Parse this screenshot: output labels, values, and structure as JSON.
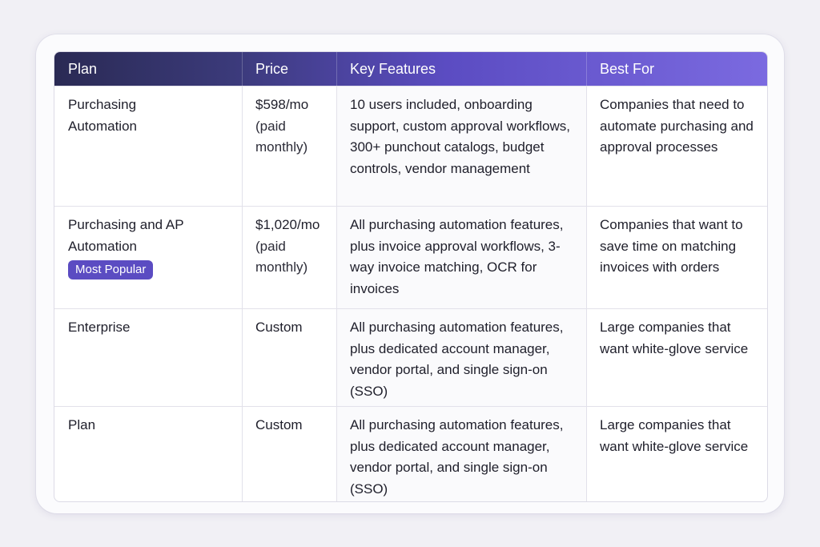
{
  "table": {
    "headers": {
      "plan": "Plan",
      "price": "Price",
      "features": "Key Features",
      "best_for": "Best For"
    },
    "rows": [
      {
        "plan": "Purchasing Automation",
        "badge": "",
        "price": "$598/mo",
        "price_note": "(paid monthly)",
        "features": "10 users included, onboarding support, custom approval workflows, 300+ punchout catalogs, budget controls, vendor management",
        "best_for": "Companies that need to automate purchasing and approval processes"
      },
      {
        "plan": "Purchasing and AP Automation",
        "badge": "Most Popular",
        "price": "$1,020/mo",
        "price_note": "(paid monthly)",
        "features": "All purchasing automation features, plus invoice approval workflows, 3-way invoice matching, OCR for invoices",
        "best_for": "Companies that want to save time on matching invoices with orders"
      },
      {
        "plan": "Enterprise",
        "badge": "",
        "price": "Custom",
        "price_note": "",
        "features": "All purchasing automation features, plus dedicated account manager, vendor portal, and single sign-on (SSO)",
        "best_for": "Large companies that want white-glove service"
      },
      {
        "plan": "Plan",
        "badge": "",
        "price": "Custom",
        "price_note": "",
        "features": "All purchasing automation features, plus dedicated account manager, vendor portal, and single sign-on (SSO)",
        "best_for": "Large companies that want white-glove service"
      }
    ]
  },
  "colors": {
    "header_start": "#2a2a54",
    "header_end": "#7b6ae0",
    "badge": "#5b4cc2"
  }
}
